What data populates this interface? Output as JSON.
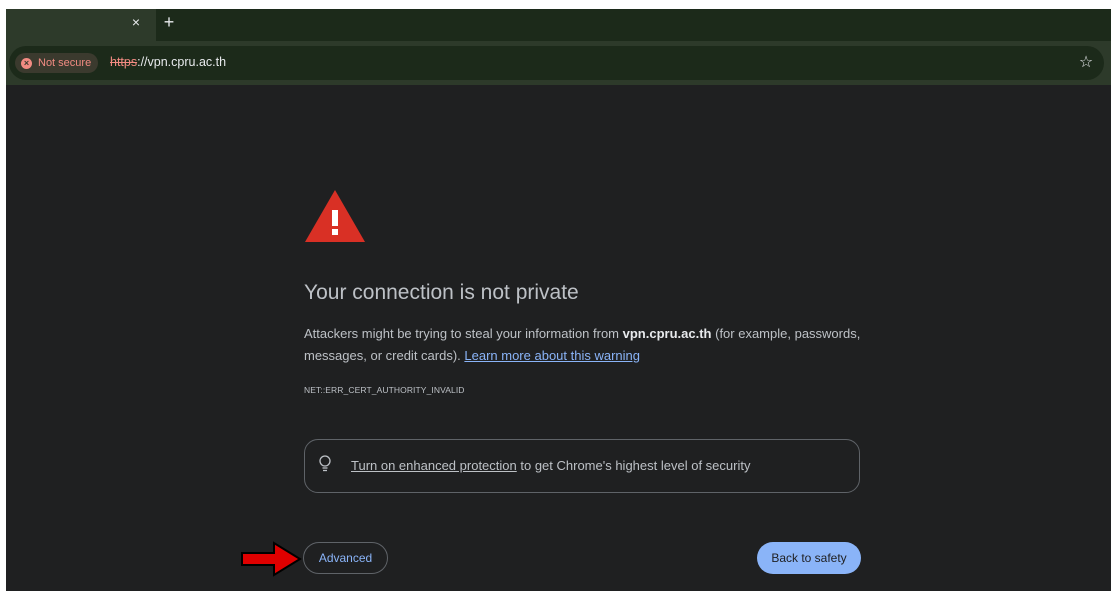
{
  "browser": {
    "tab_close_glyph": "×",
    "new_tab_glyph": "+",
    "security_chip": {
      "label": "Not secure",
      "icon": "error-circle-icon",
      "color": "#f28b82"
    },
    "url": {
      "scheme": "https",
      "rest": "://vpn.cpru.ac.th"
    },
    "bookmark_icon": "star-icon"
  },
  "interstitial": {
    "warning_icon": "warning-triangle-icon",
    "heading": "Your connection is not private",
    "desc_part1": "Attackers might be trying to steal your information from ",
    "desc_host": "vpn.cpru.ac.th",
    "desc_part2": " (for example, passwords, messages, or credit cards). ",
    "learn_more": "Learn more about this warning",
    "error_code": "NET::ERR_CERT_AUTHORITY_INVALID",
    "enhanced_link": "Turn on enhanced protection",
    "enhanced_rest": " to get Chrome's highest level of security",
    "advanced_button": "Advanced",
    "back_button": "Back to safety"
  },
  "annotation": {
    "icon": "red-arrow-icon",
    "color": "#e00000"
  },
  "colors": {
    "background": "#1f2021",
    "accent": "#8ab4f8",
    "text": "#bdc1c6",
    "warning": "#d93025"
  }
}
